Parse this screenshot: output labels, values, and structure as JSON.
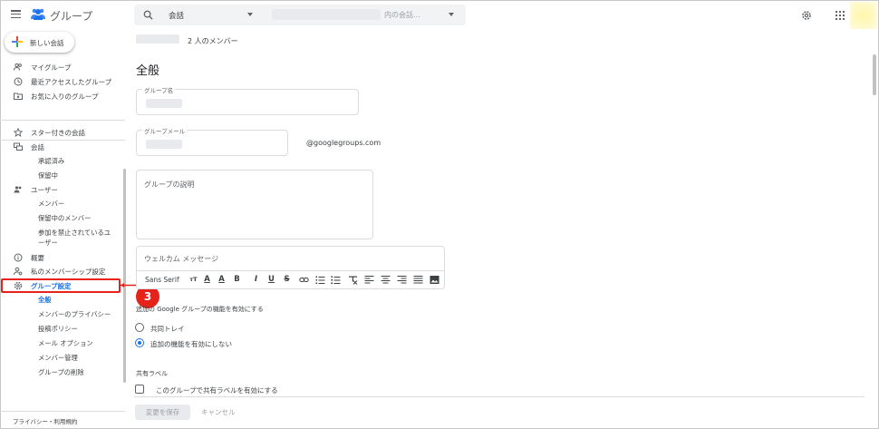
{
  "header": {
    "app_title": "グループ",
    "search_scope": "会話",
    "search_placeholder": "内の会話...",
    "icons": [
      "menu-icon",
      "groups-logo-icon",
      "search-icon",
      "settings-gear-icon",
      "apps-grid-icon"
    ]
  },
  "sidebar": {
    "new_conversation": "新しい会話",
    "top_items": [
      {
        "label": "マイグループ",
        "icon": "people-icon"
      },
      {
        "label": "最近アクセスしたグループ",
        "icon": "clock-icon"
      },
      {
        "label": "お気に入りのグループ",
        "icon": "folder-star-icon"
      }
    ],
    "starred": "スター付きの会話",
    "conversations": {
      "label": "会話",
      "children": [
        "承認済み",
        "保留中"
      ]
    },
    "users": {
      "label": "ユーザー",
      "children": [
        "メンバー",
        "保留中のメンバー",
        "参加を禁止されているユ",
        "ーザー"
      ]
    },
    "overview": "概要",
    "membership_settings": "私のメンバーシップ設定",
    "group_settings": {
      "label": "グループ設定",
      "children": [
        "全般",
        "メンバーのプライバシー",
        "投稿ポリシー",
        "メール オプション",
        "メンバー管理",
        "グループの削除"
      ]
    },
    "privacy": "プライバシー・利用規約"
  },
  "callout": {
    "number": "3",
    "color": "#e5231b"
  },
  "main": {
    "member_count": "2 人のメンバー",
    "section_title": "全般",
    "group_name_label": "グループ名",
    "group_email_label": "グループメール",
    "email_suffix": "@googlegroups.com",
    "description_placeholder": "グループの説明",
    "welcome_placeholder": "ウェルカム メッセージ",
    "toolbar": {
      "font": "Sans Serif",
      "size": "ᴛT",
      "text_color": "A",
      "highlight": "A",
      "bold": "B",
      "italic": "I",
      "underline": "U",
      "strike": "S"
    },
    "enable_heading": "追加の Google グループの機能を有効にする",
    "options": [
      "共同トレイ",
      "追加の機能を有効にしない"
    ],
    "selected_option": 1,
    "shared_label_heading": "共有ラベル",
    "shared_label_checkbox": "このグループで共有ラベルを有効にする",
    "save": "変更を保存",
    "cancel": "キャンセル"
  },
  "colors": {
    "accent": "#1a73e8",
    "highlight_red": "#e5231b"
  }
}
